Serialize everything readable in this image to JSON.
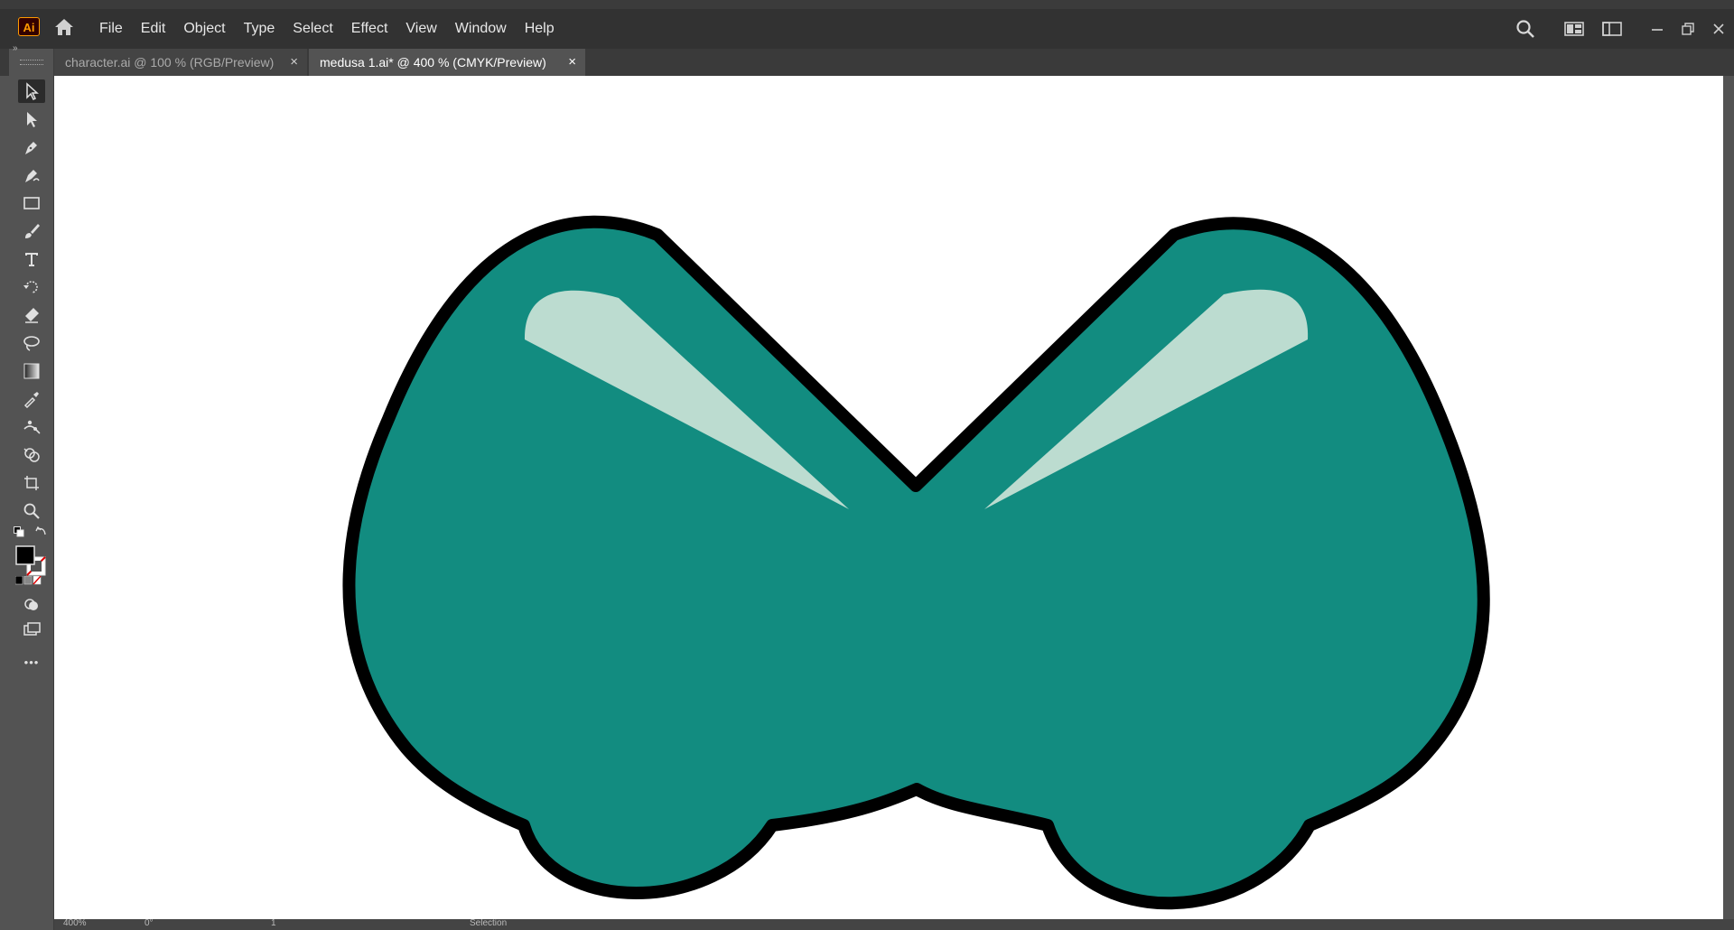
{
  "app": {
    "logo_text": "Ai"
  },
  "menu": [
    "File",
    "Edit",
    "Object",
    "Type",
    "Select",
    "Effect",
    "View",
    "Window",
    "Help"
  ],
  "tabs": [
    {
      "label": "character.ai @ 100 % (RGB/Preview)",
      "close": "×",
      "active": false
    },
    {
      "label": "medusa 1.ai* @ 400 % (CMYK/Preview)",
      "close": "×",
      "active": true
    }
  ],
  "toolbar": {
    "collapse_glyph": "»",
    "more_glyph": "•••",
    "tools": [
      "selection-tool",
      "direct-selection-tool",
      "pen-tool",
      "curvature-tool",
      "rectangle-tool",
      "paintbrush-tool",
      "type-tool",
      "rotate-tool",
      "eraser-tool",
      "lasso-tool",
      "gradient-tool",
      "eyedropper-tool",
      "puppet-warp-tool",
      "shape-builder-tool",
      "artboard-tool",
      "zoom-tool"
    ]
  },
  "status": {
    "zoom": "400%",
    "rotation": "0°",
    "artboard": "1",
    "tool": "Selection"
  },
  "colors": {
    "teal": "#128c80",
    "highlight": "#bcdcd0",
    "outline": "#000000",
    "artboard": "#ffffff",
    "ui_dark": "#323232",
    "ui_mid": "#535353"
  }
}
